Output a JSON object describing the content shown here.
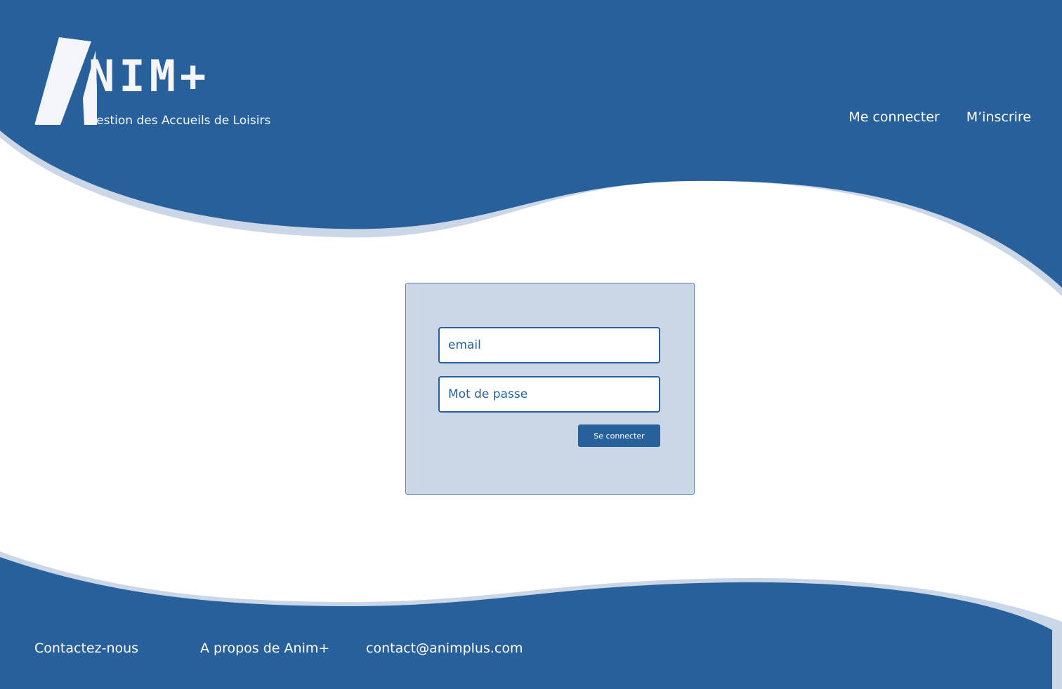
{
  "brand": {
    "name": "NIM+",
    "tagline": "Gestion des Accueils de Loisirs"
  },
  "nav": {
    "login_label": "Me connecter",
    "signup_label": "M’inscrire"
  },
  "login_form": {
    "email_placeholder": "email",
    "password_placeholder": "Mot de passe",
    "submit_label": "Se connecter"
  },
  "footer": {
    "contact_label": "Contactez-nous",
    "about_label": "A propos de Anim+",
    "email": "contact@animplus.com"
  },
  "colors": {
    "primary": "#27609b",
    "card_background": "#cbd7e7",
    "wave_highlight": "#cbd7e7",
    "logo_text": "#f4f5fa"
  },
  "icons": {
    "logo_mark": "stylized-letter-a-icon"
  }
}
